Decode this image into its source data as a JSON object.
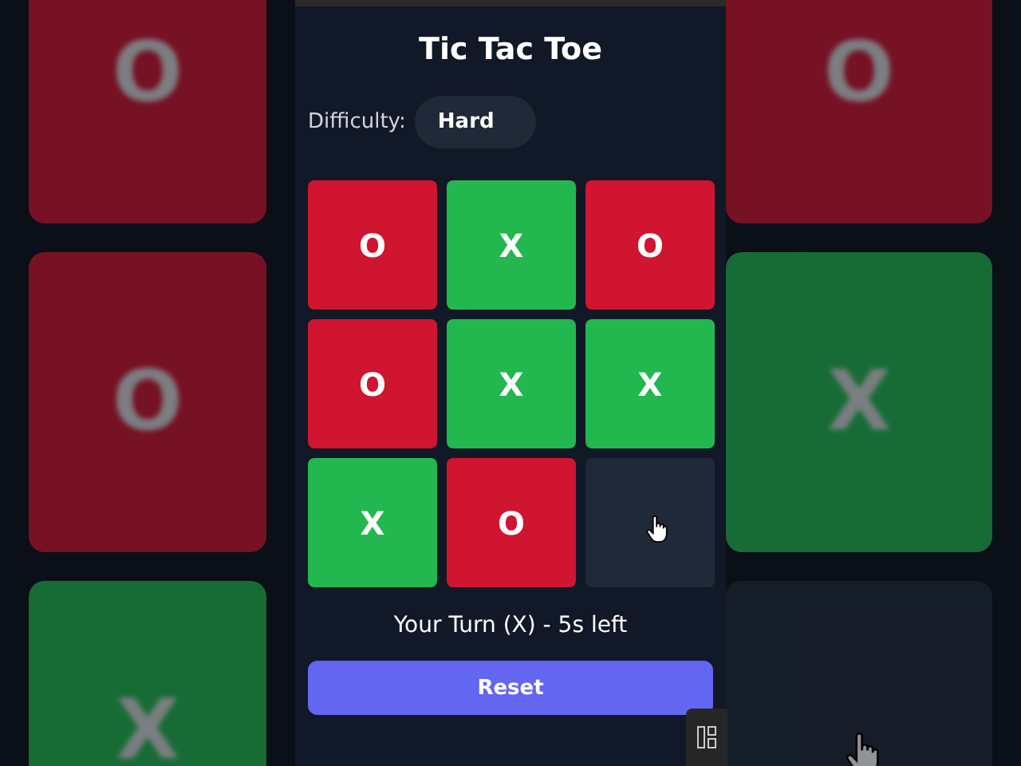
{
  "backdrop": {
    "left": [
      {
        "kind": "o",
        "mark": "O",
        "hovered": false
      },
      {
        "kind": "o",
        "mark": "O",
        "hovered": false
      },
      {
        "kind": "x",
        "mark": "X",
        "hovered": false
      }
    ],
    "right": [
      {
        "kind": "o",
        "mark": "O",
        "hovered": false
      },
      {
        "kind": "x",
        "mark": "X",
        "hovered": false
      },
      {
        "kind": "empty",
        "hovered": true
      }
    ]
  },
  "title": "Tic Tac Toe",
  "difficulty": {
    "label": "Difficulty:",
    "value": "Hard"
  },
  "board": [
    {
      "kind": "o",
      "mark": "O",
      "hovered": false
    },
    {
      "kind": "x",
      "mark": "X",
      "hovered": false
    },
    {
      "kind": "o",
      "mark": "O",
      "hovered": false
    },
    {
      "kind": "o",
      "mark": "O",
      "hovered": false
    },
    {
      "kind": "x",
      "mark": "X",
      "hovered": false
    },
    {
      "kind": "x",
      "mark": "X",
      "hovered": false
    },
    {
      "kind": "x",
      "mark": "X",
      "hovered": false
    },
    {
      "kind": "o",
      "mark": "O",
      "hovered": false
    },
    {
      "kind": "empty",
      "hovered": true
    }
  ],
  "status": "Your Turn (X) - 5s left",
  "reset_button": "Reset"
}
